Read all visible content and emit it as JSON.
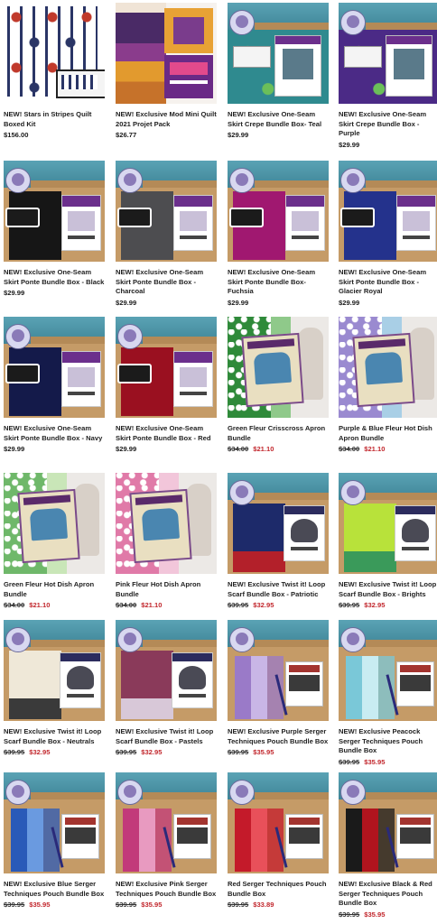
{
  "products": [
    {
      "title": "NEW! Stars in Stripes Quilt Boxed Kit",
      "price": "$156.00",
      "old_price": "",
      "sale_price": "",
      "thumb": "quilt-kit"
    },
    {
      "title": "NEW! Exclusive Mod Mini Quilt 2021 Projet Pack",
      "price": "$26.77",
      "old_price": "",
      "sale_price": "",
      "thumb": "mini-quilt"
    },
    {
      "title": "NEW! Exclusive One-Seam Skirt Crepe Bundle Box- Teal",
      "price": "$29.99",
      "old_price": "",
      "sale_price": "",
      "thumb": "crepe",
      "color": "#2f8a8f"
    },
    {
      "title": "NEW! Exclusive One-Seam Skirt Crepe Bundle Box - Purple",
      "price": "$29.99",
      "old_price": "",
      "sale_price": "",
      "thumb": "crepe",
      "color": "#4b2a86"
    },
    {
      "title": "NEW! Exclusive One-Seam Skirt Ponte Bundle Box - Black",
      "price": "$29.99",
      "old_price": "",
      "sale_price": "",
      "thumb": "ponte",
      "color": "#161616"
    },
    {
      "title": "NEW! Exclusive One-Seam Skirt Ponte Bundle Box - Charcoal",
      "price": "$29.99",
      "old_price": "",
      "sale_price": "",
      "thumb": "ponte",
      "color": "#4d4d50"
    },
    {
      "title": "NEW! Exclusive One-Seam Skirt Ponte Bundle Box- Fuchsia",
      "price": "$29.99",
      "old_price": "",
      "sale_price": "",
      "thumb": "ponte",
      "color": "#a01870"
    },
    {
      "title": "NEW! Exclusive One-Seam Skirt Ponte Bundle Box - Glacier Royal",
      "price": "$29.99",
      "old_price": "",
      "sale_price": "",
      "thumb": "ponte",
      "color": "#24328c"
    },
    {
      "title": "NEW! Exclusive One-Seam Skirt Ponte Bundle Box - Navy",
      "price": "$29.99",
      "old_price": "",
      "sale_price": "",
      "thumb": "ponte",
      "color": "#141a4a"
    },
    {
      "title": "NEW! Exclusive One-Seam Skirt Ponte Bundle Box - Red",
      "price": "$29.99",
      "old_price": "",
      "sale_price": "",
      "thumb": "ponte",
      "color": "#9a1020"
    },
    {
      "title": "Green Fleur Crisscross Apron Bundle",
      "price": "",
      "old_price": "$34.00",
      "sale_price": "$21.10",
      "thumb": "apron",
      "color": "#2f8a3a",
      "color2": "#8fc98a"
    },
    {
      "title": "Purple & Blue Fleur Hot Dish Apron Bundle",
      "price": "",
      "old_price": "$34.00",
      "sale_price": "$21.10",
      "thumb": "apron",
      "color": "#9a8ad0",
      "color2": "#a9cfe6"
    },
    {
      "title": "Green Fleur Hot Dish Apron Bundle",
      "price": "",
      "old_price": "$34.00",
      "sale_price": "$21.10",
      "thumb": "apron",
      "color": "#6fb86a",
      "color2": "#c9e6b8"
    },
    {
      "title": "Pink Fleur Hot Dish Apron Bundle",
      "price": "",
      "old_price": "$34.00",
      "sale_price": "$21.10",
      "thumb": "apron",
      "color": "#e07aa8",
      "color2": "#f2c6da"
    },
    {
      "title": "NEW! Exclusive Twist it! Loop Scarf Bundle Box - Patriotic",
      "price": "",
      "old_price": "$39.95",
      "sale_price": "$32.95",
      "thumb": "scarf",
      "color": "#1d2a6a",
      "color2": "#b3202a"
    },
    {
      "title": "NEW! Exclusive Twist it! Loop Scarf Bundle Box - Brights",
      "price": "",
      "old_price": "$39.95",
      "sale_price": "$32.95",
      "thumb": "scarf",
      "color": "#b8e23a",
      "color2": "#3a9a5a"
    },
    {
      "title": "NEW! Exclusive Twist it! Loop Scarf Bundle Box - Neutrals",
      "price": "",
      "old_price": "$39.95",
      "sale_price": "$32.95",
      "thumb": "scarf",
      "color": "#efe8d8",
      "color2": "#3a3a3a"
    },
    {
      "title": "NEW! Exclusive Twist it! Loop Scarf Bundle Box - Pastels",
      "price": "",
      "old_price": "$39.95",
      "sale_price": "$32.95",
      "thumb": "scarf",
      "color": "#8a3a5a",
      "color2": "#d8c8d8"
    },
    {
      "title": "NEW! Exclusive Purple Serger Techniques Pouch Bundle Box",
      "price": "",
      "old_price": "$39.95",
      "sale_price": "$35.95",
      "thumb": "pouch",
      "color": "#9a7ac8",
      "color2": "#c9b6e6"
    },
    {
      "title": "NEW! Exclusive Peacock Serger Techniques Pouch Bundle Box",
      "price": "",
      "old_price": "$39.95",
      "sale_price": "$35.95",
      "thumb": "pouch",
      "color": "#7ac8d8",
      "color2": "#c8ecf2"
    },
    {
      "title": "NEW! Exclusive Blue Serger Techniques Pouch Bundle Box",
      "price": "",
      "old_price": "$39.95",
      "sale_price": "$35.95",
      "thumb": "pouch",
      "color": "#2a5ab8",
      "color2": "#6a9ae0"
    },
    {
      "title": "NEW! Exclusive Pink Serger Techniques Pouch Bundle Box",
      "price": "",
      "old_price": "$39.95",
      "sale_price": "$35.95",
      "thumb": "pouch",
      "color": "#c23a7a",
      "color2": "#e89ac0"
    },
    {
      "title": "Red Serger Techniques Pouch Bundle Box",
      "price": "",
      "old_price": "$39.95",
      "sale_price": "$33.89",
      "thumb": "pouch",
      "color": "#c41a2a",
      "color2": "#e8505a"
    },
    {
      "title": "NEW! Exclusive Black & Red Serger Techniques Pouch Bundle Box",
      "price": "",
      "old_price": "$39.95",
      "sale_price": "$35.95",
      "thumb": "pouch",
      "color": "#1a1a1a",
      "color2": "#b0141e"
    }
  ],
  "colors": {
    "sale": "#c2272d",
    "text": "#222222",
    "box_lid": "#4a95a8",
    "box_body": "#c59b67"
  }
}
